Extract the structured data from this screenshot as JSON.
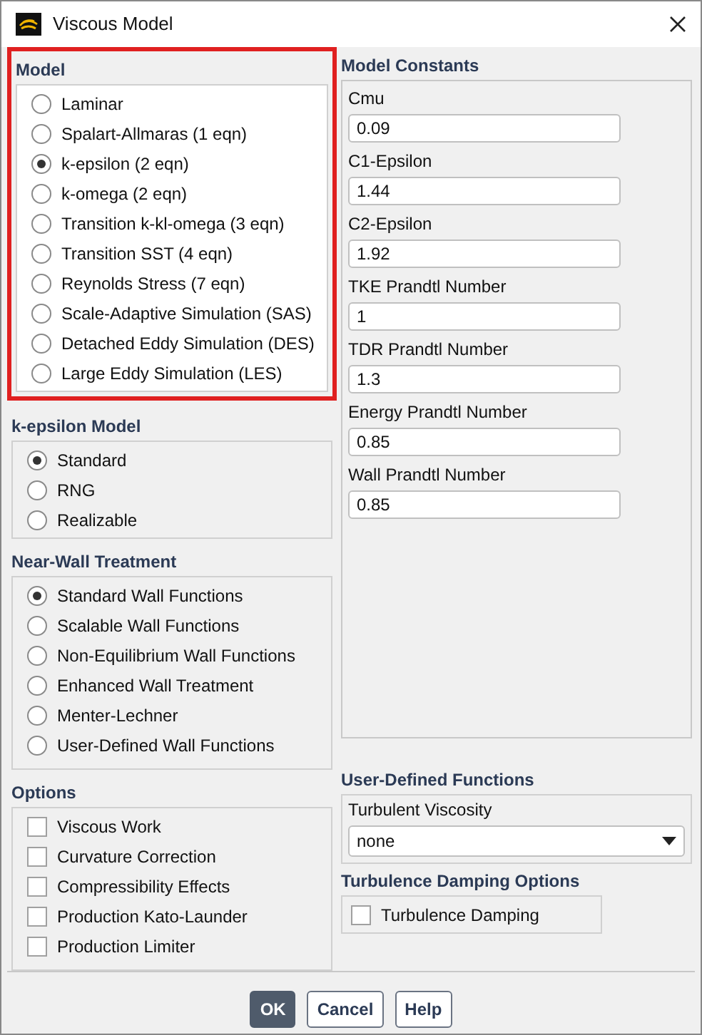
{
  "window": {
    "title": "Viscous Model"
  },
  "model": {
    "label": "Model",
    "highlighted": true,
    "options": [
      {
        "label": "Laminar",
        "selected": false
      },
      {
        "label": "Spalart-Allmaras (1 eqn)",
        "selected": false
      },
      {
        "label": "k-epsilon (2 eqn)",
        "selected": true
      },
      {
        "label": "k-omega (2 eqn)",
        "selected": false
      },
      {
        "label": "Transition k-kl-omega (3 eqn)",
        "selected": false
      },
      {
        "label": "Transition SST (4 eqn)",
        "selected": false
      },
      {
        "label": "Reynolds Stress (7 eqn)",
        "selected": false
      },
      {
        "label": "Scale-Adaptive Simulation (SAS)",
        "selected": false
      },
      {
        "label": "Detached Eddy Simulation (DES)",
        "selected": false
      },
      {
        "label": "Large Eddy Simulation (LES)",
        "selected": false
      }
    ]
  },
  "k_epsilon_model": {
    "label": "k-epsilon Model",
    "options": [
      {
        "label": "Standard",
        "selected": true
      },
      {
        "label": "RNG",
        "selected": false
      },
      {
        "label": "Realizable",
        "selected": false
      }
    ]
  },
  "near_wall_treatment": {
    "label": "Near-Wall Treatment",
    "options": [
      {
        "label": "Standard Wall Functions",
        "selected": true
      },
      {
        "label": "Scalable Wall Functions",
        "selected": false
      },
      {
        "label": "Non-Equilibrium Wall Functions",
        "selected": false
      },
      {
        "label": "Enhanced Wall Treatment",
        "selected": false
      },
      {
        "label": "Menter-Lechner",
        "selected": false
      },
      {
        "label": "User-Defined Wall Functions",
        "selected": false
      }
    ]
  },
  "options": {
    "label": "Options",
    "items": [
      {
        "label": "Viscous Work",
        "checked": false
      },
      {
        "label": "Curvature Correction",
        "checked": false
      },
      {
        "label": "Compressibility Effects",
        "checked": false
      },
      {
        "label": "Production Kato-Launder",
        "checked": false
      },
      {
        "label": "Production Limiter",
        "checked": false
      }
    ]
  },
  "model_constants": {
    "label": "Model Constants",
    "fields": [
      {
        "label": "Cmu",
        "value": "0.09"
      },
      {
        "label": "C1-Epsilon",
        "value": "1.44"
      },
      {
        "label": "C2-Epsilon",
        "value": "1.92"
      },
      {
        "label": "TKE Prandtl Number",
        "value": "1"
      },
      {
        "label": "TDR Prandtl Number",
        "value": "1.3"
      },
      {
        "label": "Energy Prandtl Number",
        "value": "0.85"
      },
      {
        "label": "Wall Prandtl Number",
        "value": "0.85"
      }
    ]
  },
  "user_defined_functions": {
    "label": "User-Defined Functions",
    "field_label": "Turbulent Viscosity",
    "value": "none"
  },
  "turbulence_damping_options": {
    "label": "Turbulence Damping Options",
    "items": [
      {
        "label": "Turbulence Damping",
        "checked": false
      }
    ]
  },
  "buttons": [
    {
      "label": "OK",
      "primary": true
    },
    {
      "label": "Cancel",
      "primary": false
    },
    {
      "label": "Help",
      "primary": false
    }
  ]
}
